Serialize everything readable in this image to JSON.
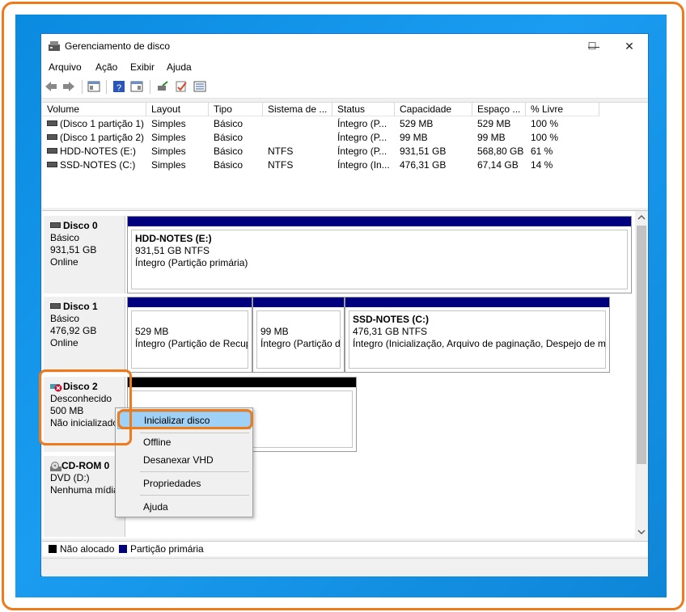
{
  "window": {
    "title": "Gerenciamento de disco",
    "controls": {
      "minimize": "—",
      "maximize": "☐",
      "close": "✕"
    }
  },
  "menu": [
    "Arquivo",
    "Ação",
    "Exibir",
    "Ajuda"
  ],
  "toolbar_icons": [
    "back-icon",
    "forward-icon",
    "properties-icon",
    "help-icon",
    "view-icon",
    "connect-icon",
    "check-icon",
    "list-icon"
  ],
  "volume_table": {
    "columns": [
      "Volume",
      "Layout",
      "Tipo",
      "Sistema de ...",
      "Status",
      "Capacidade",
      "Espaço ...",
      "% Livre"
    ],
    "rows": [
      [
        "(Disco 1 partição 1)",
        "Simples",
        "Básico",
        "",
        "Íntegro (P...",
        "529 MB",
        "529 MB",
        "100 %"
      ],
      [
        "(Disco 1 partição 2)",
        "Simples",
        "Básico",
        "",
        "Íntegro (P...",
        "99 MB",
        "99 MB",
        "100 %"
      ],
      [
        "HDD-NOTES (E:)",
        "Simples",
        "Básico",
        "NTFS",
        "Íntegro (P...",
        "931,51 GB",
        "568,80 GB",
        "61 %"
      ],
      [
        "SSD-NOTES (C:)",
        "Simples",
        "Básico",
        "NTFS",
        "Íntegro (In...",
        "476,31 GB",
        "67,14 GB",
        "14 %"
      ]
    ]
  },
  "disks": [
    {
      "name": "Disco 0",
      "line1": "Básico",
      "line2": "931,51 GB",
      "line3": "Online",
      "partitions": [
        {
          "name": "HDD-NOTES  (E:)",
          "size": "931,51 GB NTFS",
          "status": "Íntegro (Partição primária)"
        }
      ]
    },
    {
      "name": "Disco 1",
      "line1": "Básico",
      "line2": "476,92 GB",
      "line3": "Online",
      "partitions": [
        {
          "name": "",
          "size": "529 MB",
          "status": "Íntegro (Partição de Recup"
        },
        {
          "name": "",
          "size": "99 MB",
          "status": "Íntegro (Partição d"
        },
        {
          "name": "SSD-NOTES  (C:)",
          "size": "476,31 GB NTFS",
          "status": "Íntegro (Inicialização, Arquivo de paginação, Despejo de m"
        }
      ]
    },
    {
      "name": "Disco 2",
      "line1": "Desconhecido",
      "line2": "500 MB",
      "line3": "Não inicializado"
    },
    {
      "name": "CD-ROM 0",
      "line1": "DVD (D:)",
      "line2": "",
      "line3": "Nenhuma mídia"
    }
  ],
  "legend": {
    "unallocated": "Não alocado",
    "primary": "Partição primária"
  },
  "context_menu": [
    "Inicializar disco",
    "Offline",
    "Desanexar VHD",
    "Propriedades",
    "Ajuda"
  ],
  "colors": {
    "primary_partition": "#00007f",
    "unallocated": "#000000",
    "highlight": "#ef7a1a",
    "desktop": "#0a8be0"
  }
}
